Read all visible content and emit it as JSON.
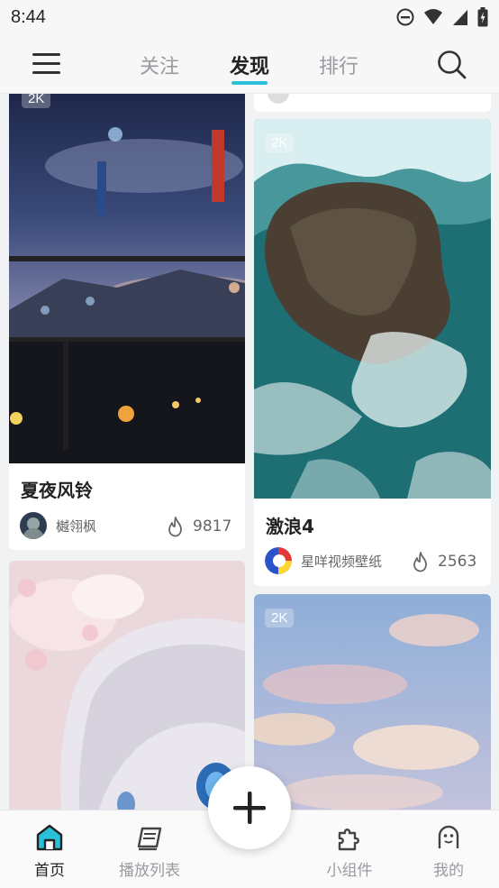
{
  "status_bar": {
    "time": "8:44"
  },
  "top_nav": {
    "tabs": [
      {
        "label": "关注"
      },
      {
        "label": "发现"
      },
      {
        "label": "排行"
      }
    ]
  },
  "feed": {
    "cards": [
      {
        "badge": "2K",
        "title": "夏夜风铃",
        "author": "樾翎枫",
        "likes": "9817"
      },
      {
        "badge": "2K",
        "title": "激浪4",
        "author": "星咩视频壁纸",
        "likes": "2563"
      },
      {
        "badge": "2K"
      }
    ]
  },
  "bottom_nav": {
    "items": [
      {
        "label": "首页"
      },
      {
        "label": "播放列表"
      },
      {
        "label": "小组件"
      },
      {
        "label": "我的"
      }
    ]
  },
  "colors": {
    "accent": "#2ac0d9",
    "active_text": "#222222",
    "inactive_text": "#9a9aa0"
  }
}
